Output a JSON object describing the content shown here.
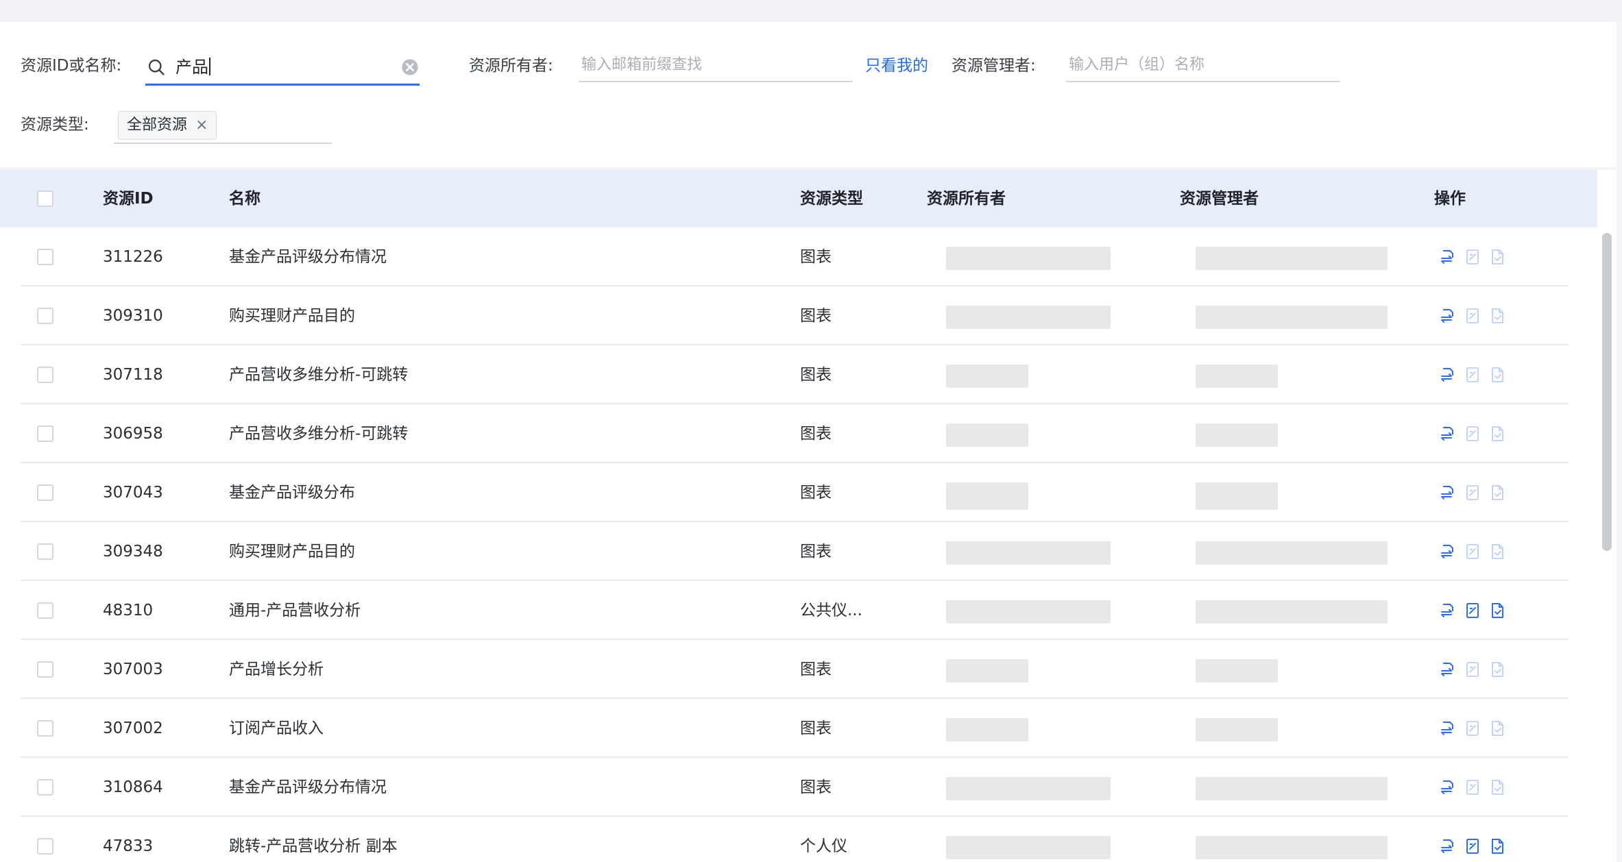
{
  "filters": {
    "id_or_name_label": "资源ID或名称:",
    "search_value": "产品",
    "owner_label": "资源所有者:",
    "owner_placeholder": "输入邮箱前缀查找",
    "only_mine_link": "只看我的",
    "manager_label": "资源管理者:",
    "manager_placeholder": "输入用户（组）名称",
    "type_label": "资源类型:",
    "type_tag": "全部资源",
    "tag_close": "×"
  },
  "table": {
    "columns": {
      "id": "资源ID",
      "name": "名称",
      "type": "资源类型",
      "owner": "资源所有者",
      "manager": "资源管理者",
      "actions": "操作"
    },
    "rows": [
      {
        "id": "311226",
        "name": "基金产品评级分布情况",
        "type": "图表",
        "actions_enabled": false
      },
      {
        "id": "309310",
        "name": "购买理财产品目的",
        "type": "图表",
        "actions_enabled": false
      },
      {
        "id": "307118",
        "name": "产品营收多维分析-可跳转",
        "type": "图表",
        "actions_enabled": false
      },
      {
        "id": "306958",
        "name": "产品营收多维分析-可跳转",
        "type": "图表",
        "actions_enabled": false
      },
      {
        "id": "307043",
        "name": "基金产品评级分布",
        "type": "图表",
        "actions_enabled": false
      },
      {
        "id": "309348",
        "name": "购买理财产品目的",
        "type": "图表",
        "actions_enabled": false
      },
      {
        "id": "48310",
        "name": "通用-产品营收分析",
        "type": "公共仪...",
        "actions_enabled": true
      },
      {
        "id": "307003",
        "name": "产品增长分析",
        "type": "图表",
        "actions_enabled": false
      },
      {
        "id": "307002",
        "name": "订阅产品收入",
        "type": "图表",
        "actions_enabled": false
      },
      {
        "id": "310864",
        "name": "基金产品评级分布情况",
        "type": "图表",
        "actions_enabled": false
      },
      {
        "id": "47833",
        "name": "跳转-产品营收分析 副本",
        "type": "个人仪",
        "actions_enabled": true
      }
    ]
  },
  "icons": {
    "search": "search-icon",
    "clear": "clear-circle-icon",
    "transfer": "transfer-owner-icon",
    "edit": "edit-permission-icon",
    "doc": "document-icon"
  },
  "colors": {
    "accent": "#2e6cff",
    "link": "#1f6aff",
    "header_bg": "#e7edfb",
    "icon_active": "#2e6cff",
    "icon_disabled": "#c3d3f5"
  }
}
